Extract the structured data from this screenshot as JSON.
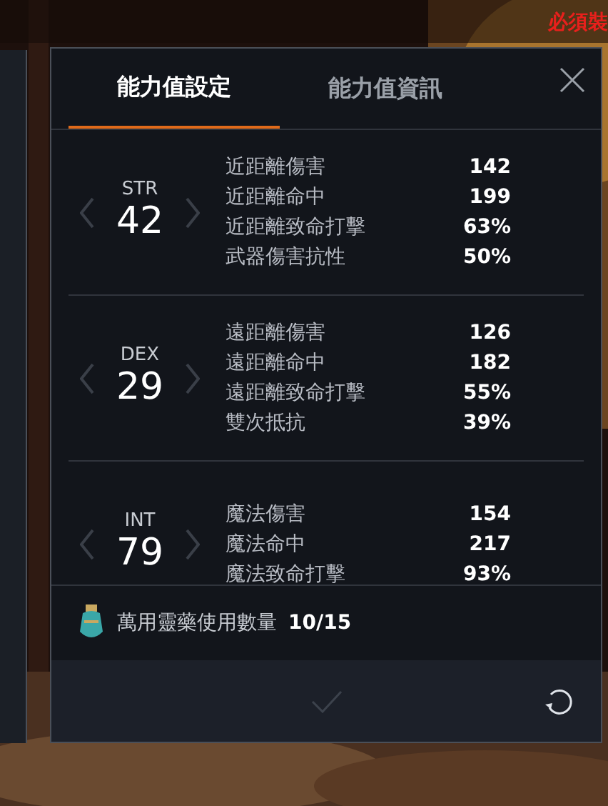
{
  "background_text": "必須裝",
  "tabs": [
    {
      "label": "能力值設定",
      "selected": true
    },
    {
      "label": "能力值資訊",
      "selected": false
    }
  ],
  "attributes": [
    {
      "name": "STR",
      "value": "42",
      "stats": [
        {
          "label": "近距離傷害",
          "value": "142"
        },
        {
          "label": "近距離命中",
          "value": "199"
        },
        {
          "label": "近距離致命打擊",
          "value": "63%"
        },
        {
          "label": "武器傷害抗性",
          "value": "50%"
        }
      ]
    },
    {
      "name": "DEX",
      "value": "29",
      "stats": [
        {
          "label": "遠距離傷害",
          "value": "126"
        },
        {
          "label": "遠距離命中",
          "value": "182"
        },
        {
          "label": "遠距離致命打擊",
          "value": "55%"
        },
        {
          "label": "雙次抵抗",
          "value": "39%"
        }
      ]
    },
    {
      "name": "INT",
      "value": "79",
      "stats": [
        {
          "label": "魔法傷害",
          "value": "154"
        },
        {
          "label": "魔法命中",
          "value": "217"
        },
        {
          "label": "魔法致命打擊",
          "value": "93%"
        }
      ]
    }
  ],
  "elixir": {
    "label": "萬用靈藥使用數量",
    "count": "10/15"
  },
  "confirm": {
    "disabled": true
  }
}
